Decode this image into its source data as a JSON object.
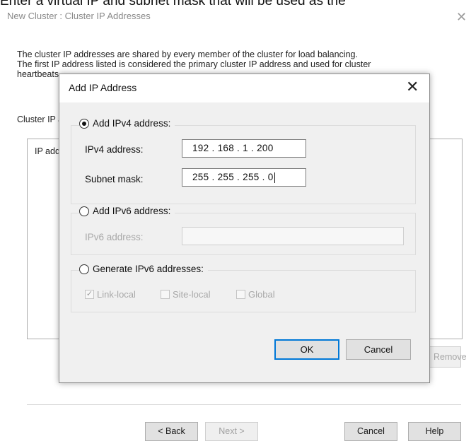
{
  "top_caption": "Enter a virtual IP and subnet mask that will be used as the",
  "window": {
    "title": "New Cluster : Cluster IP Addresses",
    "close_glyph": "✕"
  },
  "intro": {
    "line1": "The cluster IP addresses are shared by every member of the cluster for load balancing.",
    "line2": "The first IP address listed is considered the primary cluster IP address and used for cluster",
    "line3": "heartbeats."
  },
  "cluster_label": "Cluster IP addresses:",
  "list": {
    "header": "IP address"
  },
  "remove_label": "Remove",
  "footer": {
    "back": "< Back",
    "next": "Next >",
    "cancel": "Cancel",
    "help": "Help"
  },
  "dialog": {
    "title": "Add IP Address",
    "close_glyph": "✕",
    "ipv4": {
      "option_label": "Add IPv4 address:",
      "selected": true,
      "address_label": "IPv4 address:",
      "address_value": "192 . 168 .  1  . 200",
      "mask_label": "Subnet mask:",
      "mask_value": "255 . 255 . 255 .  0"
    },
    "ipv6": {
      "option_label": "Add IPv6 address:",
      "selected": false,
      "address_label": "IPv6 address:",
      "address_value": ""
    },
    "generate": {
      "option_label": "Generate IPv6 addresses:",
      "selected": false,
      "link_local": "Link-local",
      "link_local_checked": true,
      "site_local": "Site-local",
      "site_local_checked": false,
      "global": "Global",
      "global_checked": false
    },
    "ok": "OK",
    "cancel": "Cancel"
  },
  "colors": {
    "accent": "#0078d7",
    "dialog_bg": "#f0f0f0",
    "disabled_text": "#a8a8a8"
  }
}
